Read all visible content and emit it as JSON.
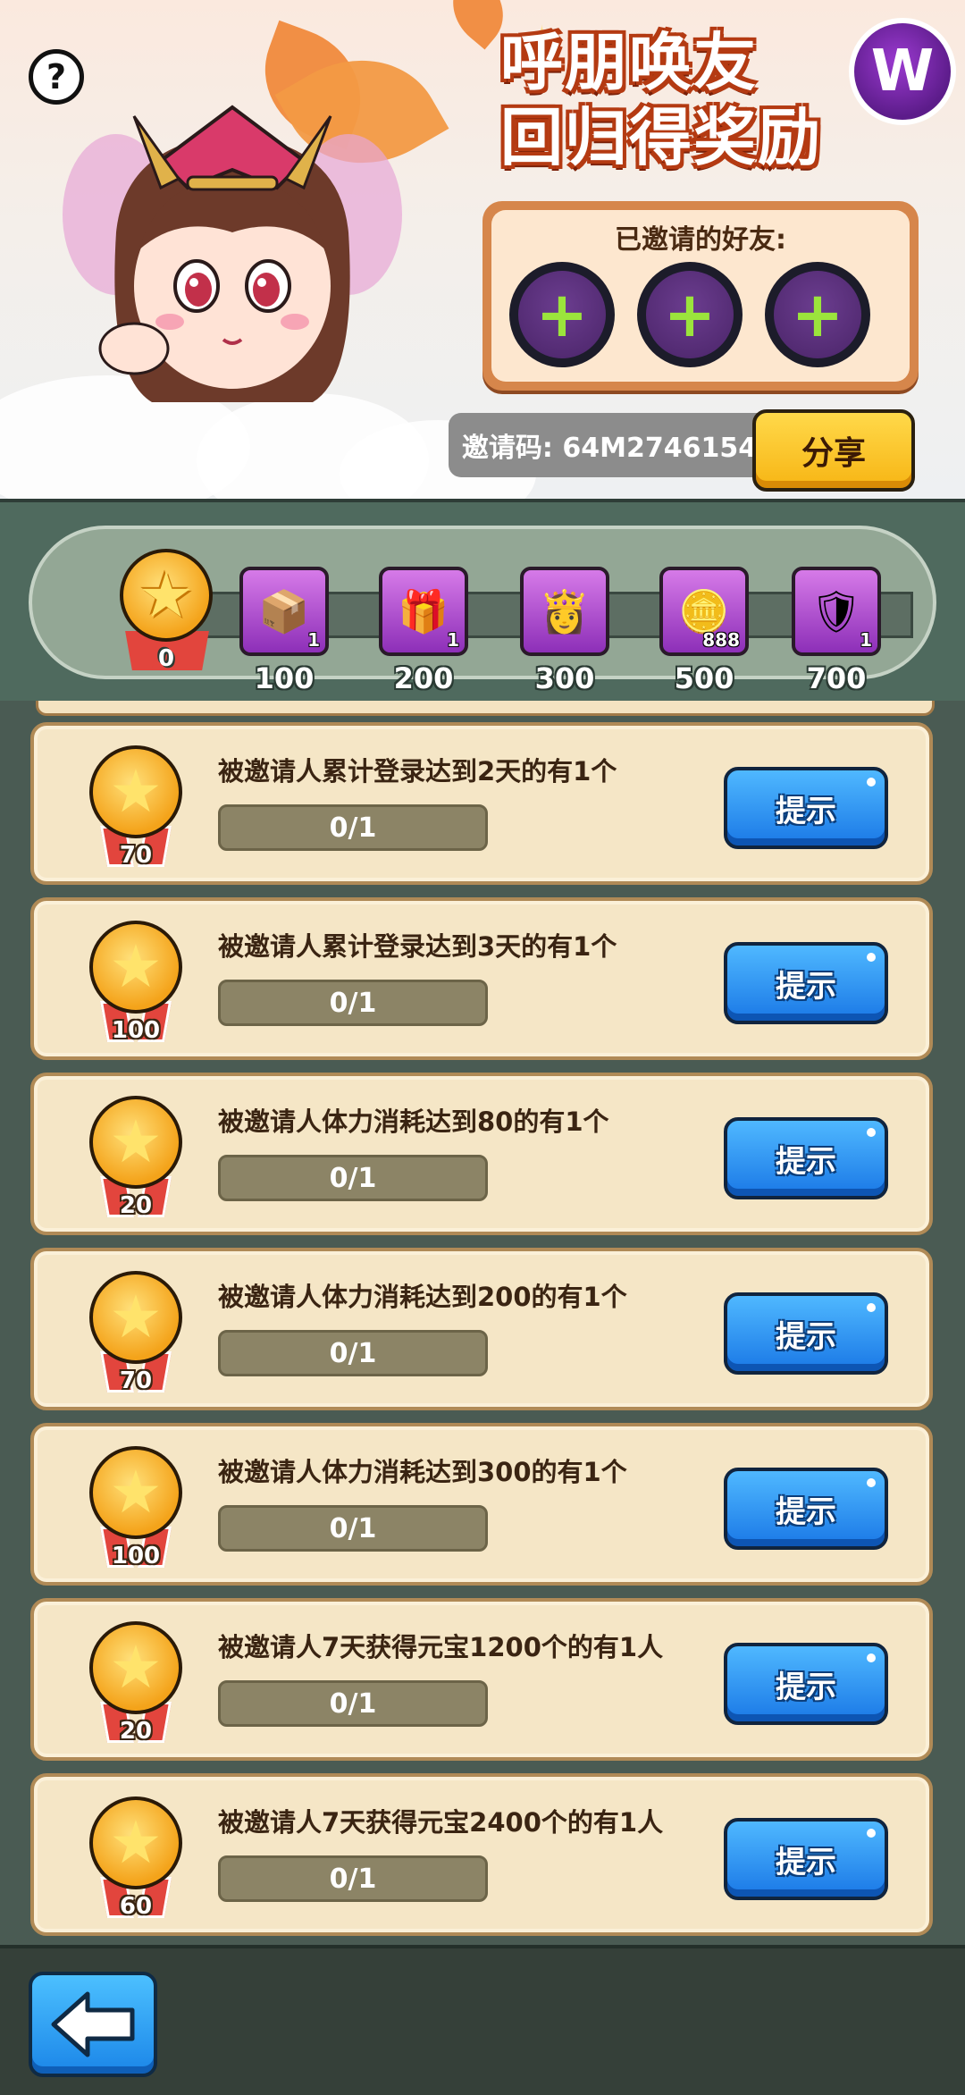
{
  "header": {
    "title_line1": "呼朋唤友",
    "title_line2": "回归得奖励",
    "brand_logo_letter": "W",
    "help_glyph": "?",
    "invited_label": "已邀请的好友:",
    "invite_slots": [
      "+",
      "+",
      "+"
    ],
    "invite_code_text": "邀请码: 64M2746154",
    "share_label": "分享"
  },
  "progress": {
    "current_points": "0",
    "milestones": [
      {
        "points": "100",
        "icon": "upgrade-chest-icon",
        "count": "1"
      },
      {
        "points": "200",
        "icon": "upgrade-treasure-icon",
        "count": "1"
      },
      {
        "points": "300",
        "icon": "hero-portrait-icon",
        "count": ""
      },
      {
        "points": "500",
        "icon": "gold-ingot-icon",
        "count": "888"
      },
      {
        "points": "700",
        "icon": "golden-armor-icon",
        "count": "1"
      }
    ]
  },
  "tasks": [
    {
      "desc": "被邀请人累计登录达到2天的有1个",
      "progress": "0/1",
      "points": "70",
      "button": "提示"
    },
    {
      "desc": "被邀请人累计登录达到3天的有1个",
      "progress": "0/1",
      "points": "100",
      "button": "提示"
    },
    {
      "desc": "被邀请人体力消耗达到80的有1个",
      "progress": "0/1",
      "points": "20",
      "button": "提示"
    },
    {
      "desc": "被邀请人体力消耗达到200的有1个",
      "progress": "0/1",
      "points": "70",
      "button": "提示"
    },
    {
      "desc": "被邀请人体力消耗达到300的有1个",
      "progress": "0/1",
      "points": "100",
      "button": "提示"
    },
    {
      "desc": "被邀请人7天获得元宝1200个的有1人",
      "progress": "0/1",
      "points": "20",
      "button": "提示"
    },
    {
      "desc": "被邀请人7天获得元宝2400个的有1人",
      "progress": "0/1",
      "points": "60",
      "button": "提示"
    }
  ],
  "colors": {
    "hint_button": "#1a78e6",
    "share_button": "#f7b514",
    "card_bg": "#f5e6c6",
    "medal": "#f4a31a"
  }
}
